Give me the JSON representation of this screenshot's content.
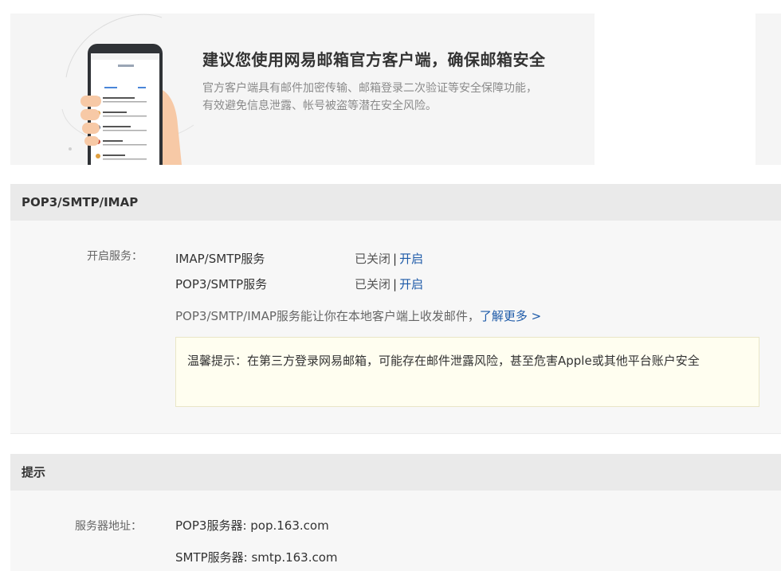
{
  "banner": {
    "title": "建议您使用网易邮箱官方客户端，确保邮箱安全",
    "description": "官方客户端具有邮件加密传输、邮箱登录二次验证等安全保障功能，有效避免信息泄露、帐号被盗等潜在安全风险。"
  },
  "pop_section": {
    "header": "POP3/SMTP/IMAP",
    "service_label": "开启服务：",
    "services": [
      {
        "name": "IMAP/SMTP服务",
        "status": "已关闭",
        "separator": "|",
        "action": "开启"
      },
      {
        "name": "POP3/SMTP服务",
        "status": "已关闭",
        "separator": "|",
        "action": "开启"
      }
    ],
    "description": "POP3/SMTP/IMAP服务能让你在本地客户端上收发邮件，",
    "learn_more": "了解更多 >",
    "warning": "温馨提示：在第三方登录网易邮箱，可能存在邮件泄露风险，甚至危害Apple或其他平台账户安全"
  },
  "tips_section": {
    "header": "提示",
    "server_label": "服务器地址：",
    "pop3_server": "POP3服务器: pop.163.com",
    "smtp_server": "SMTP服务器: smtp.163.com"
  },
  "colors": {
    "link": "#1d5aa8",
    "header_bg": "#eaeaea",
    "body_bg": "#f7f7f7",
    "warning_bg": "#fffef0"
  }
}
